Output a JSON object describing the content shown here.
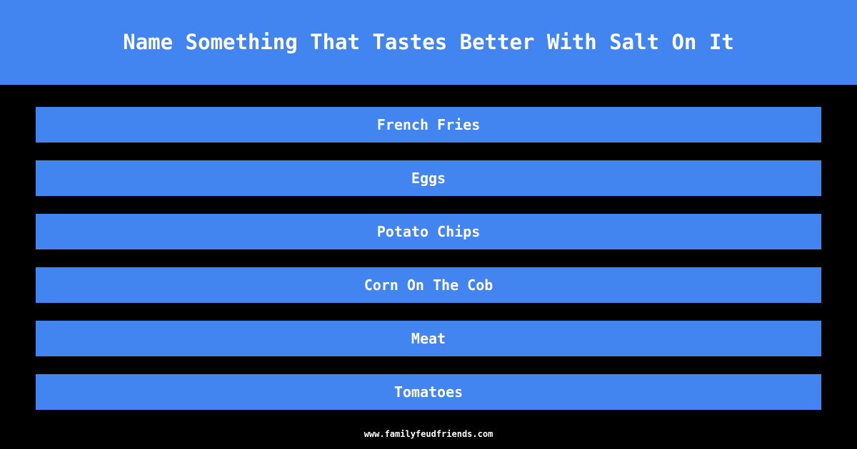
{
  "colors": {
    "background": "#000000",
    "accent_blue": "#4285f0",
    "text_white": "#ffffff"
  },
  "header": {
    "title": "Name Something That Tastes Better With Salt On It"
  },
  "answers": [
    {
      "label": "French Fries"
    },
    {
      "label": "Eggs"
    },
    {
      "label": "Potato Chips"
    },
    {
      "label": "Corn On The Cob"
    },
    {
      "label": "Meat"
    },
    {
      "label": "Tomatoes"
    }
  ],
  "footer": {
    "site": "www.familyfeudfriends.com"
  }
}
